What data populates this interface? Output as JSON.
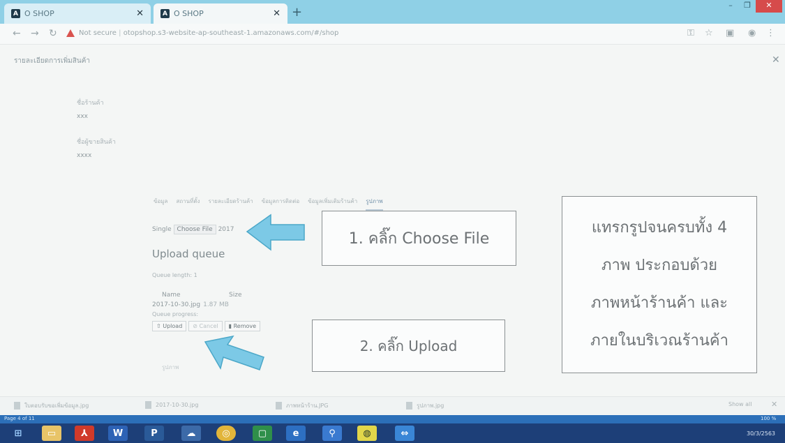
{
  "browser": {
    "tabs": [
      {
        "title": "O SHOP",
        "active": false
      },
      {
        "title": "O SHOP",
        "active": true
      }
    ],
    "url_prefix": "Not secure",
    "url_host": "otopshop.s3-website-ap-southeast-1.amazonaws.com",
    "url_path": "/#/shop"
  },
  "page": {
    "modal_title": "รายละเอียดการเพิ่มสินค้า",
    "fields": [
      {
        "label": "ชื่อร้านค้า",
        "value": "xxx"
      },
      {
        "label": "ชื่อผู้ขายสินค้า",
        "value": "xxxx"
      }
    ],
    "tabs": [
      "ข้อมูล",
      "สถานที่ตั้ง",
      "รายละเอียดร้านค้า",
      "ข้อมูลการติดต่อ",
      "ข้อมูลเพิ่มเติมร้านค้า",
      "รูปภาพ"
    ],
    "active_tab": 5,
    "single_label": "Single",
    "choose_file": "Choose File",
    "chosen_file": "2017",
    "upload_queue": "Upload queue",
    "queue_length": "Queue length: 1",
    "col_name": "Name",
    "col_size": "Size",
    "file_name": "2017-10-30.jpg",
    "file_size": "1.87 MB",
    "queue_progress": "Queue progress:",
    "btn_upload": "Upload",
    "btn_cancel": "Cancel",
    "btn_remove": "Remove",
    "faint_text": "รูปภาพ"
  },
  "annotations": {
    "step1": "1. คลิ๊ก Choose File",
    "step2": "2. คลิ๊ก Upload",
    "note_lines": [
      "แทรกรูปจนครบทั้ง 4",
      "ภาพ ประกอบด้วย",
      "ภาพหน้าร้านค้า และ",
      "ภายในบริเวณร้านค้า"
    ]
  },
  "downloads": {
    "items": [
      "ใบตอบรับขอเพิ่มข้อมูล.jpg",
      "2017-10-30.jpg",
      "ภาพหน้าร้าน.JPG",
      "รูปภาพ.jpg"
    ],
    "show_all": "Show all"
  },
  "status": {
    "page": "Page 4 of 11",
    "zoom": "100 %"
  },
  "taskbar": {
    "date": "30/3/2563"
  },
  "colors": {
    "arrow": "#7cc9e6",
    "taskbar": "#1d3f78",
    "tabbar": "#8fd0e6"
  }
}
